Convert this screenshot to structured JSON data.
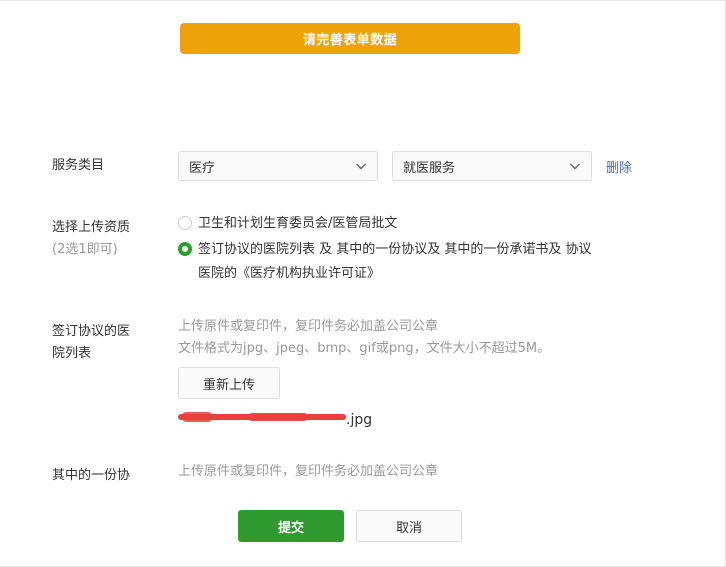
{
  "notice": {
    "text": "请完善表单数据"
  },
  "service": {
    "label": "服务类目",
    "category_value": "医疗",
    "subcategory_value": "就医服务",
    "delete_label": "删除"
  },
  "qualification": {
    "label": "选择上传资质",
    "sub_label": "(2选1即可)",
    "options": [
      {
        "text": "卫生和计划生育委员会/医管局批文",
        "checked": false
      },
      {
        "text_line1": "签订协议的医院列表 及 其中的一份协议及 其中的一份承诺书及 协议",
        "text_line2": "医院的《医疗机构执业许可证》",
        "checked": true
      }
    ]
  },
  "hospital_list": {
    "label_line1": "签订协议的医",
    "label_line2": "院列表",
    "hint_line1": "上传原件或复印件，复印件务必加盖公司公章",
    "hint_line2": "文件格式为jpg、jpeg、bmp、gif或png，文件大小不超过5M。",
    "reupload_label": "重新上传",
    "file_ext": ".jpg"
  },
  "agreement": {
    "label": "其中的一份协",
    "hint": "上传原件或复印件，复印件务必加盖公司公章"
  },
  "footer": {
    "submit_label": "提交",
    "cancel_label": "取消"
  },
  "colors": {
    "notice_bg": "#eea30a",
    "primary_green": "#2f9a2f",
    "link_blue": "#4a6ea9",
    "redaction_red": "#e8413c"
  }
}
